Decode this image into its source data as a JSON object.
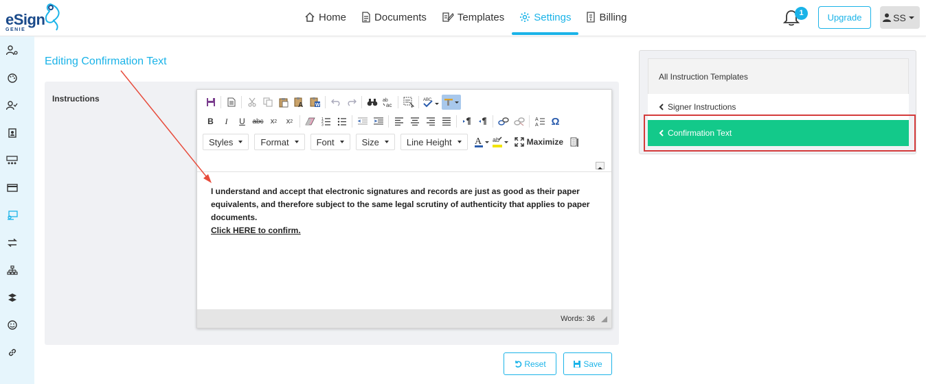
{
  "brand": {
    "name": "eSign",
    "sub": "GENIE"
  },
  "nav": [
    {
      "label": "Home",
      "icon": "home-icon"
    },
    {
      "label": "Documents",
      "icon": "document-icon"
    },
    {
      "label": "Templates",
      "icon": "template-icon"
    },
    {
      "label": "Settings",
      "icon": "gear-icon",
      "active": true
    },
    {
      "label": "Billing",
      "icon": "billing-icon"
    }
  ],
  "header": {
    "notification_count": "1",
    "upgrade_label": "Upgrade",
    "user_initials": "SS"
  },
  "page": {
    "title": "Editing Confirmation Text",
    "field_label": "Instructions"
  },
  "editor": {
    "combos": [
      "Styles",
      "Format",
      "Font",
      "Size",
      "Line Height"
    ],
    "maximize_label": "Maximize",
    "text": "I understand and accept that electronic signatures and records are just as good as their paper equivalents, and therefore subject to the same legal scrutiny of authenticity that applies to paper documents.",
    "link_text": "Click HERE to confirm.",
    "words_label": "Words: 36"
  },
  "actions": {
    "reset_label": "Reset",
    "save_label": "Save"
  },
  "right_panel": {
    "heading": "All Instruction Templates",
    "items": [
      {
        "label": "Signer Instructions"
      },
      {
        "label": "Confirmation Text",
        "active": true
      }
    ]
  },
  "colors": {
    "accent": "#1ab3e8",
    "active_item": "#13c98a",
    "highlight": "#d43a3a",
    "annotation_arrow": "#e74c3c"
  }
}
